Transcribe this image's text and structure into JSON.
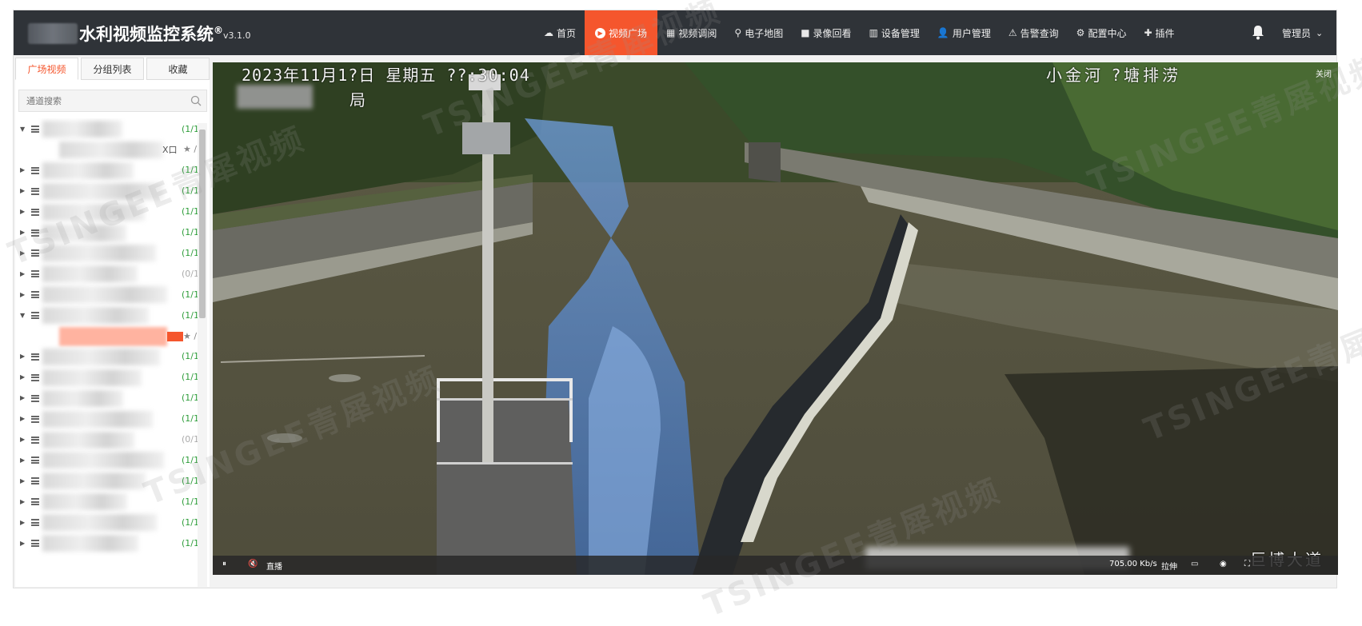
{
  "header": {
    "app_title": "水利视频监控系统",
    "registered_mark": "®",
    "version": "v3.1.0",
    "nav": [
      {
        "label": "首页",
        "icon": "cloud-icon",
        "glyph": "☁"
      },
      {
        "label": "视频广场",
        "icon": "play-icon",
        "glyph": "▶",
        "active": true
      },
      {
        "label": "视频调阅",
        "icon": "grid-icon",
        "glyph": "▦"
      },
      {
        "label": "电子地图",
        "icon": "map-pin-icon",
        "glyph": "⚲"
      },
      {
        "label": "录像回看",
        "icon": "camera-icon",
        "glyph": "■"
      },
      {
        "label": "设备管理",
        "icon": "device-icon",
        "glyph": "▥"
      },
      {
        "label": "用户管理",
        "icon": "user-icon",
        "glyph": "👤"
      },
      {
        "label": "告警查询",
        "icon": "alarm-icon",
        "glyph": "⚠"
      },
      {
        "label": "配置中心",
        "icon": "gear-icon",
        "glyph": "⚙"
      },
      {
        "label": "插件",
        "icon": "puzzle-icon",
        "glyph": "✚"
      }
    ],
    "user_label": "管理员",
    "user_chevron": "⌄",
    "accent": "#f5562d",
    "bar_color": "#2f3338"
  },
  "sidebar": {
    "tabs": [
      {
        "label": "广场视频",
        "active": true
      },
      {
        "label": "分组列表"
      },
      {
        "label": "收藏"
      }
    ],
    "search_placeholder": "通道搜索",
    "tree": [
      {
        "type": "group",
        "expanded": true,
        "count": "(1/1"
      },
      {
        "type": "channel",
        "suffix": "X口",
        "star": "★ /"
      },
      {
        "type": "group",
        "count": "(1/1"
      },
      {
        "type": "group",
        "count": "(1/1"
      },
      {
        "type": "group",
        "count": "(1/1"
      },
      {
        "type": "group",
        "count": "(1/1"
      },
      {
        "type": "group",
        "count": "(1/1"
      },
      {
        "type": "group",
        "count": "(0/1",
        "offline": true
      },
      {
        "type": "group",
        "count": "(1/1"
      },
      {
        "type": "group",
        "expanded": true,
        "count": "(1/1"
      },
      {
        "type": "channel-selected",
        "star": "★ /"
      },
      {
        "type": "group",
        "count": "(1/1"
      },
      {
        "type": "group",
        "count": "(1/1"
      },
      {
        "type": "group",
        "count": "(1/1"
      },
      {
        "type": "group",
        "count": "(1/1"
      },
      {
        "type": "group",
        "count": "(0/1",
        "offline": true
      },
      {
        "type": "group",
        "count": "(1/1"
      },
      {
        "type": "group",
        "count": "(1/1"
      },
      {
        "type": "group",
        "count": "(1/1"
      },
      {
        "type": "group",
        "count": "(1/1"
      },
      {
        "type": "group",
        "count": "(1/1"
      }
    ]
  },
  "player": {
    "osd_datetime": "2023年11月1?日 星期五 ??:30:04",
    "osd_location": "小金河 ?塘排涝",
    "osd_bureau": "局",
    "osd_road": "巨博大道",
    "close_label": "关闭",
    "controls": {
      "pause_icon": "⏸",
      "mute_icon": "🔇",
      "live_label": "直播",
      "bitrate": "705.00 Kb/s",
      "stretch_label": "拉伸",
      "screen_icon": "▭",
      "snapshot_icon": "◉",
      "fullscreen_icon": "⛶"
    }
  },
  "watermark_text": "TSINGEE青犀视频"
}
